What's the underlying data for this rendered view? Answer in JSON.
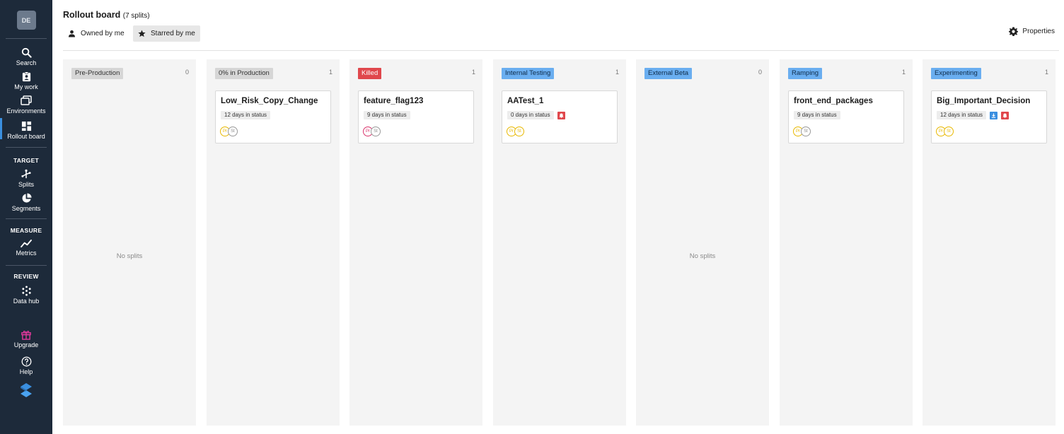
{
  "sidebar": {
    "avatar": "DE",
    "items": {
      "search": "Search",
      "my_work": "My work",
      "environments": "Environments",
      "rollout_board": "Rollout board",
      "splits": "Splits",
      "segments": "Segments",
      "metrics": "Metrics",
      "data_hub": "Data hub",
      "upgrade": "Upgrade",
      "help": "Help"
    },
    "sections": {
      "target": "TARGET",
      "measure": "MEASURE",
      "review": "REVIEW"
    },
    "colors": {
      "background": "#1d2a3a",
      "active_indicator": "#3a8fe0",
      "upgrade": "#e0389c",
      "logo": "#3a8fe0"
    }
  },
  "header": {
    "title": "Rollout board",
    "count": "(7 splits)",
    "filters": {
      "owned": "Owned by me",
      "starred": "Starred by me"
    },
    "properties": "Properties"
  },
  "columns": [
    {
      "label": "Pre-Production",
      "count": "0",
      "tag_bg": "#d6d6d6",
      "tag_fg": "#333333",
      "empty": "No splits"
    },
    {
      "label": "0% in Production",
      "count": "1",
      "tag_bg": "#d6d6d6",
      "tag_fg": "#333333",
      "card": {
        "name": "Low_Risk_Copy_Change",
        "days": "12 days in status",
        "circles": [
          "Pr",
          "St"
        ],
        "circle_colors": [
          "#e8b800",
          "#999999"
        ]
      }
    },
    {
      "label": "Killed",
      "count": "1",
      "tag_bg": "#e0474c",
      "tag_fg": "#ffffff",
      "card": {
        "name": "feature_flag123",
        "days": "9 days in status",
        "circles": [
          "Pr",
          "St"
        ],
        "circle_colors": [
          "#d9336b",
          "#999999"
        ]
      }
    },
    {
      "label": "Internal Testing",
      "count": "1",
      "tag_bg": "#6aaef0",
      "tag_fg": "#0f2c4a",
      "card": {
        "name": "AATest_1",
        "days": "0 days in status",
        "alert": true,
        "circles": [
          "Pr",
          "St"
        ],
        "circle_colors": [
          "#e8b800",
          "#e8b800"
        ]
      }
    },
    {
      "label": "External Beta",
      "count": "0",
      "tag_bg": "#6aaef0",
      "tag_fg": "#0f2c4a",
      "empty": "No splits"
    },
    {
      "label": "Ramping",
      "count": "1",
      "tag_bg": "#6aaef0",
      "tag_fg": "#0f2c4a",
      "card": {
        "name": "front_end_packages",
        "days": "9 days in status",
        "circles": [
          "Pr",
          "St"
        ],
        "circle_colors": [
          "#e8b800",
          "#999999"
        ]
      }
    },
    {
      "label": "Experimenting",
      "count": "1",
      "tag_bg": "#6aaef0",
      "tag_fg": "#0f2c4a",
      "card": {
        "name": "Big_Important_Decision",
        "days": "12 days in status",
        "download": true,
        "alert": true,
        "circles": [
          "Pr",
          "St"
        ],
        "circle_colors": [
          "#e8b800",
          "#e8b800"
        ]
      }
    }
  ],
  "icons": {
    "search": "search-icon",
    "my_work": "clipboard-user-icon",
    "environments": "layers-icon",
    "rollout_board": "board-grid-icon",
    "splits": "split-branch-icon",
    "segments": "pie-segments-icon",
    "metrics": "line-chart-icon",
    "data_hub": "dots-grid-icon",
    "upgrade": "gift-icon",
    "help": "help-circle-icon",
    "logo": "split-logo-icon",
    "owned": "user-icon",
    "starred": "star-icon",
    "properties": "gear-icon",
    "alert": "bell-icon",
    "download": "download-icon"
  }
}
